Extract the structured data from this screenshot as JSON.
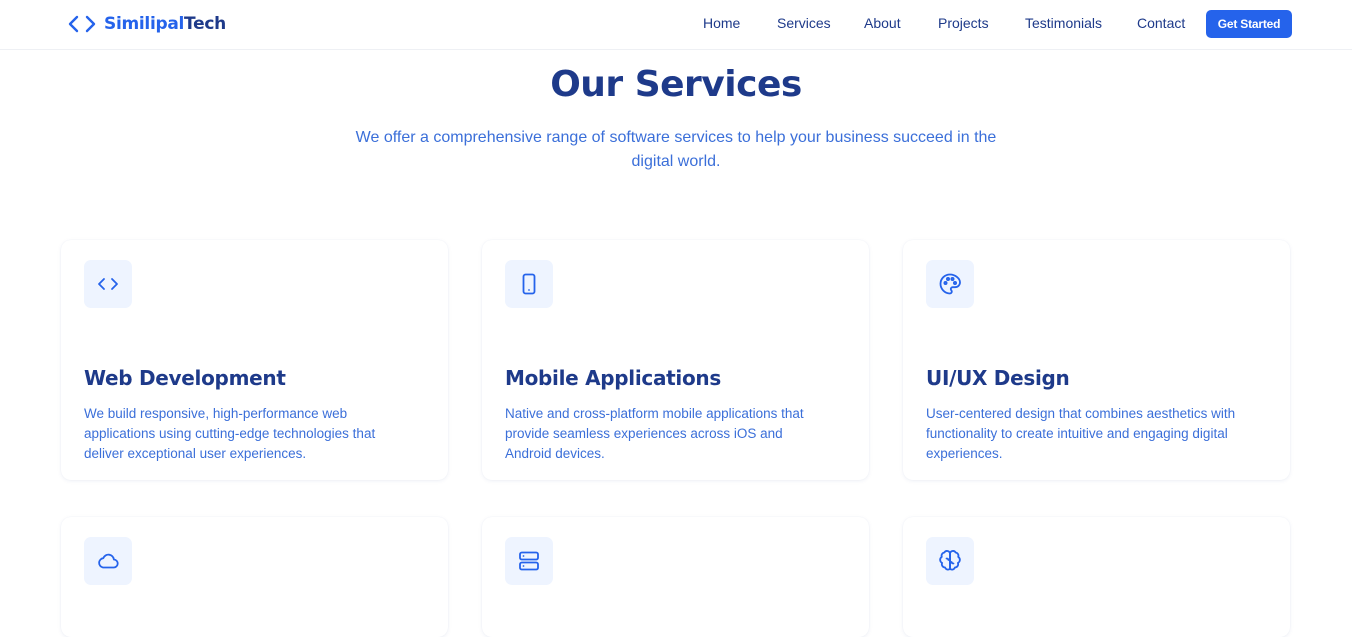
{
  "brand": {
    "part1": "Similipal",
    "part2": "Tech",
    "icon": "code-brackets-icon"
  },
  "nav": {
    "items": [
      "Home",
      "Services",
      "About",
      "Projects",
      "Testimonials",
      "Contact"
    ],
    "cta": "Get Started"
  },
  "section": {
    "title": "Our Services",
    "subtitle": "We offer a comprehensive range of software services to help your business succeed in the digital world."
  },
  "services": [
    {
      "icon": "code-icon",
      "title": "Web Development",
      "description": "We build responsive, high-performance web applications using cutting-edge technologies that deliver exceptional user experiences."
    },
    {
      "icon": "smartphone-icon",
      "title": "Mobile Applications",
      "description": "Native and cross-platform mobile applications that provide seamless experiences across iOS and Android devices."
    },
    {
      "icon": "palette-icon",
      "title": "UI/UX Design",
      "description": "User-centered design that combines aesthetics with functionality to create intuitive and engaging digital experiences."
    },
    {
      "icon": "cloud-icon",
      "title": "",
      "description": ""
    },
    {
      "icon": "server-icon",
      "title": "",
      "description": ""
    },
    {
      "icon": "brain-icon",
      "title": "",
      "description": ""
    }
  ],
  "colors": {
    "accent": "#2563eb",
    "heading": "#1e3a8a",
    "body_text": "#3b6fd9",
    "icon_bg": "#eef4ff"
  }
}
